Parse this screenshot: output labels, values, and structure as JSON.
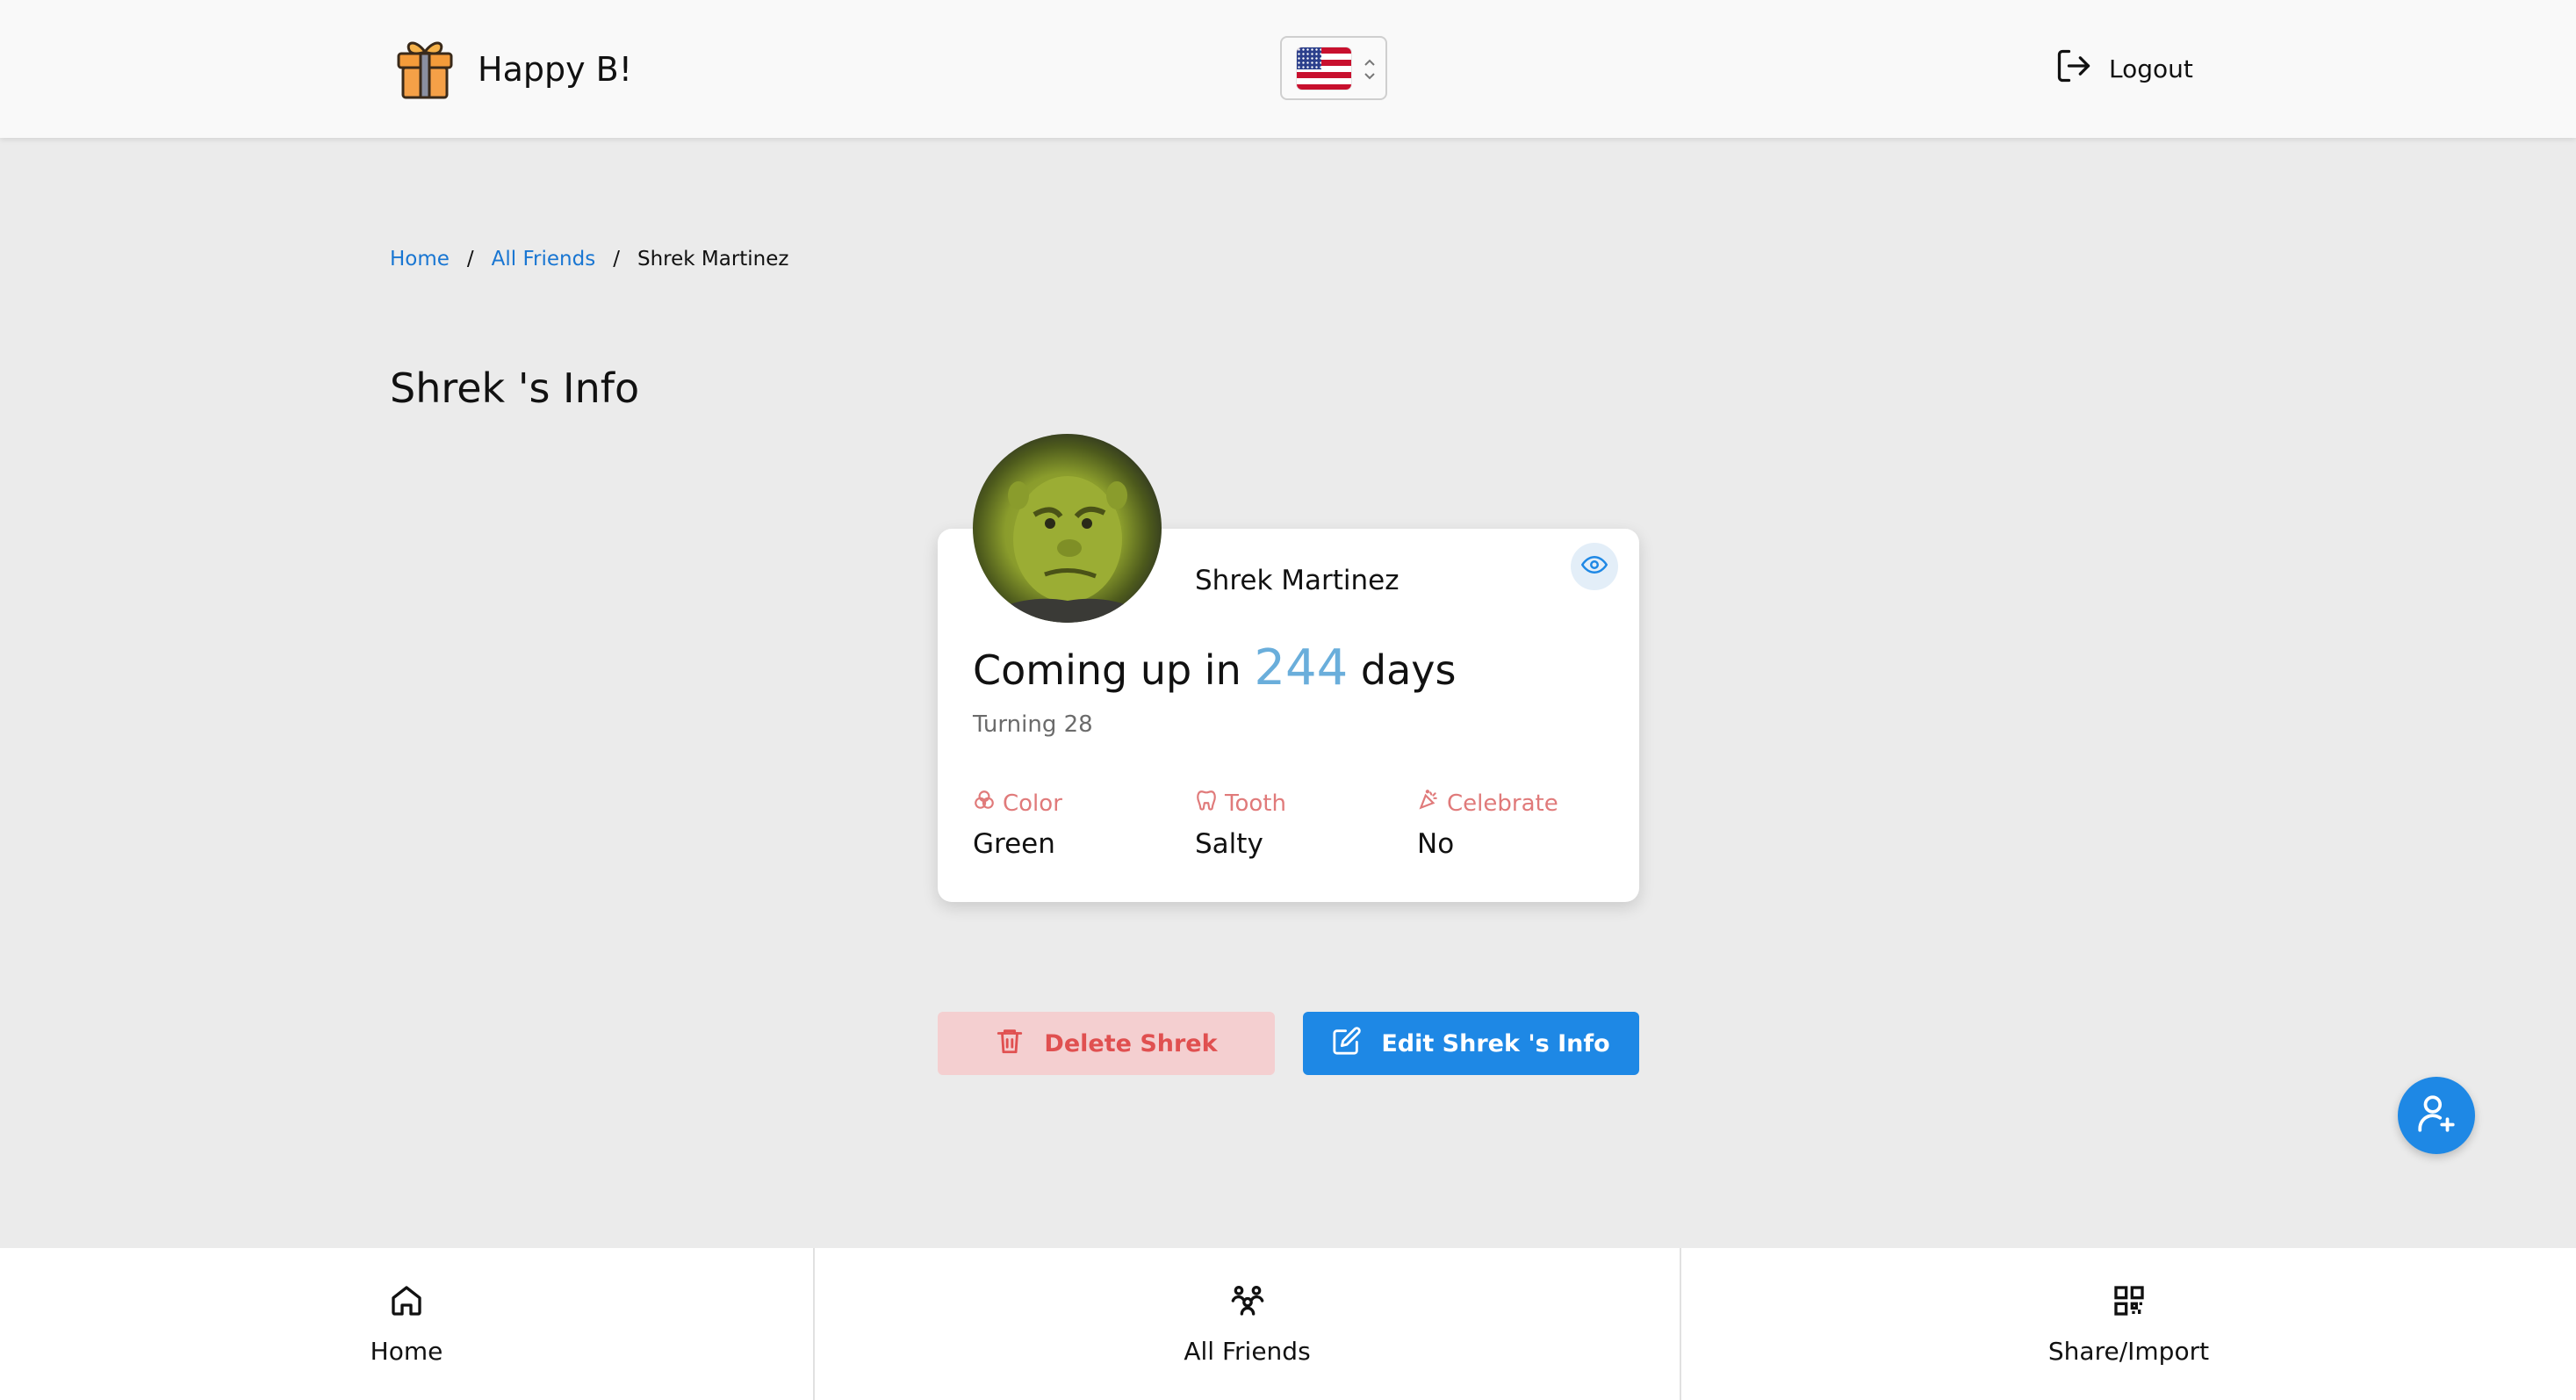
{
  "header": {
    "brand_title": "Happy B!",
    "brand_icon": "gift-box-icon",
    "language_flag": "us-flag-icon",
    "logout_label": "Logout"
  },
  "breadcrumb": {
    "items": [
      "Home",
      "All Friends"
    ],
    "current": "Shrek Martinez",
    "separator": "/"
  },
  "page": {
    "title": "Shrek 's Info"
  },
  "friend": {
    "name": "Shrek Martinez",
    "coming_prefix": "Coming up in",
    "days": "244",
    "coming_suffix": "days",
    "turning": "Turning 28",
    "attributes": [
      {
        "icon": "palette-icon",
        "label": "Color",
        "value": "Green"
      },
      {
        "icon": "tooth-icon",
        "label": "Tooth",
        "value": "Salty"
      },
      {
        "icon": "party-popper-icon",
        "label": "Celebrate",
        "value": "No"
      }
    ]
  },
  "actions": {
    "delete_label": "Delete Shrek",
    "edit_label": "Edit Shrek 's Info"
  },
  "bottom_nav": [
    {
      "label": "Home",
      "icon": "home-icon"
    },
    {
      "label": "All Friends",
      "icon": "friends-icon"
    },
    {
      "label": "Share/Import",
      "icon": "qr-code-icon"
    }
  ],
  "colors": {
    "accent": "#1e88e5",
    "link": "#1976d2",
    "days_highlight": "#6aaedb",
    "attribute_label": "#e07a7a",
    "delete_bg": "#f4cfd0",
    "delete_text": "#e05050",
    "background": "#ebebeb"
  }
}
